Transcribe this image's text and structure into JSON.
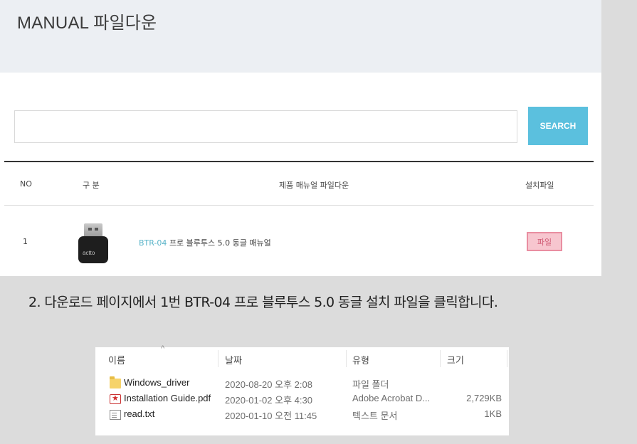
{
  "page": {
    "title": "MANUAL 파일다운"
  },
  "search": {
    "value": "",
    "placeholder": "",
    "button_label": "SEARCH"
  },
  "table": {
    "columns": [
      "NO",
      "구 분",
      "제품 매뉴얼 파일다운",
      "설치파일"
    ],
    "rows": [
      {
        "no": "1",
        "product_image": "usb-bluetooth-dongle",
        "image_brand": "actto",
        "model": "BTR-04",
        "title": "프로 블루투스 5.0 동글 매뉴얼",
        "file_label": "파일"
      }
    ]
  },
  "instruction": "2. 다운로드 페이지에서 1번 BTR-04 프로 블루투스 5.0 동글 설치 파일을 클릭합니다.",
  "explorer": {
    "columns": [
      "이름",
      "날짜",
      "유형",
      "크기"
    ],
    "files": [
      {
        "icon": "folder-icon",
        "name": "Windows_driver",
        "date": "2020-08-20 오후 2:08",
        "type": "파일 폴더",
        "size": ""
      },
      {
        "icon": "pdf-icon",
        "name": "Installation Guide.pdf",
        "date": "2020-01-02 오후 4:30",
        "type": "Adobe Acrobat D...",
        "size": "2,729KB"
      },
      {
        "icon": "text-file-icon",
        "name": "read.txt",
        "date": "2020-01-10 오전 11:45",
        "type": "텍스트 문서",
        "size": "1KB"
      }
    ]
  },
  "colors": {
    "accent": "#5bc0de",
    "link": "#5ab4c9",
    "file_button_bg": "#f7c6cf",
    "file_button_border": "#e98ea1",
    "header_bg": "#eceff3",
    "page_bg": "#dcdcdc"
  }
}
